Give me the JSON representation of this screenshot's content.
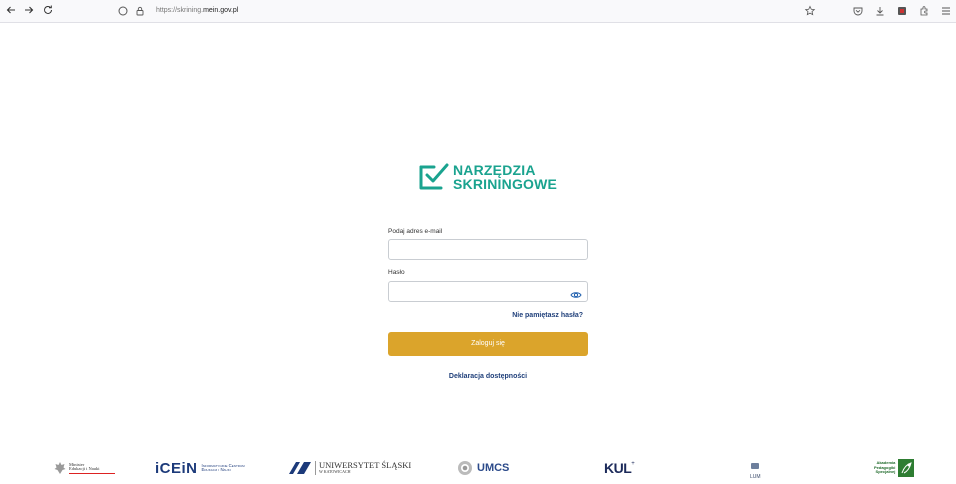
{
  "browser": {
    "url_prefix": "https://",
    "url_host": "skrining.",
    "url_domain": "mein.gov.pl"
  },
  "brand": {
    "line1": "NARZĘDZIA",
    "line2": "SKRININGOWE",
    "color": "#1aa38f"
  },
  "form": {
    "email_label": "Podaj adres e-mail",
    "email_value": "",
    "password_label": "Hasło",
    "password_value": "",
    "forgot_link": "Nie pamiętasz hasła?",
    "submit_label": "Zaloguj się",
    "submit_color": "#dba42b"
  },
  "footer": {
    "accessibility_link": "Deklaracja dostępności"
  },
  "logos": {
    "mein_line1": "Minister",
    "mein_line2": "Edukacji i Nauki",
    "icein_mark": "iCEiN",
    "icein_line1": "Informatyczne Centrum",
    "icein_line2": "Edukacji i Nauki",
    "us_line1": "UNIWERSYTET ŚLĄSKI",
    "us_line2": "W KATOWICACH",
    "umcs": "UMCS",
    "kul": "KUL",
    "lum": "LUM",
    "aps_line1": "Akademia",
    "aps_line2": "Pedagogiki",
    "aps_line3": "Specjalnej"
  }
}
